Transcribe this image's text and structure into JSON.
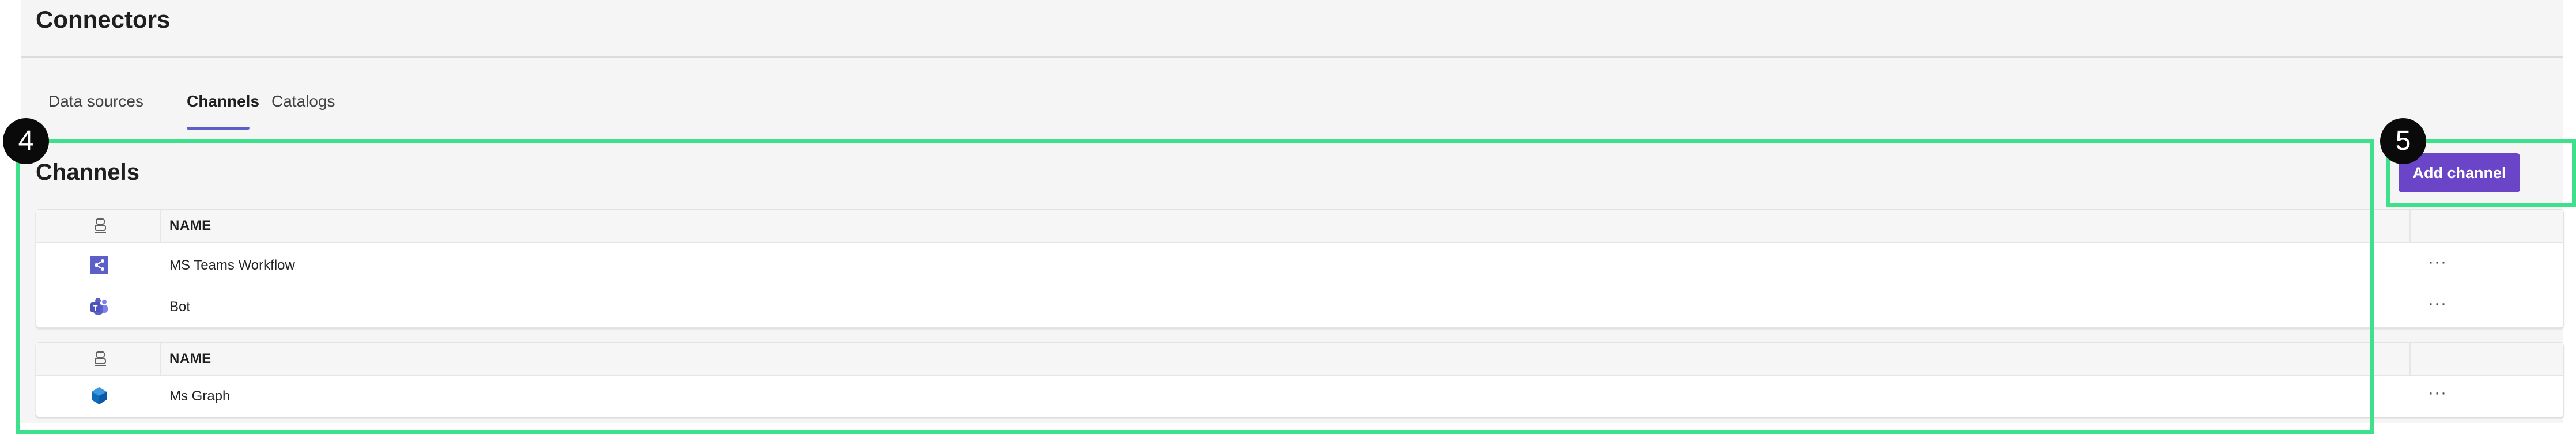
{
  "page": {
    "title": "Connectors"
  },
  "tabs": [
    {
      "label": "Data sources",
      "active": false
    },
    {
      "label": "Channels",
      "active": true
    },
    {
      "label": "Catalogs",
      "active": false
    }
  ],
  "section": {
    "title": "Channels",
    "add_button_label": "Add channel"
  },
  "tables": [
    {
      "header": {
        "type_icon": "channel-type-icon",
        "name": "NAME"
      },
      "rows": [
        {
          "icon": "ms-teams-workflow-icon",
          "name": "MS Teams Workflow",
          "more": "···"
        },
        {
          "icon": "teams-bot-icon",
          "name": "Bot",
          "more": "···"
        }
      ]
    },
    {
      "header": {
        "type_icon": "channel-type-icon",
        "name": "NAME"
      },
      "rows": [
        {
          "icon": "ms-graph-icon",
          "name": "Ms Graph",
          "more": "···"
        }
      ]
    }
  ],
  "annotations": {
    "callout_4": "4",
    "callout_5": "5",
    "highlight_color": "#3fe08c"
  },
  "colors": {
    "accent": "#6b45c8",
    "tab_underline": "#5b5fc7"
  }
}
